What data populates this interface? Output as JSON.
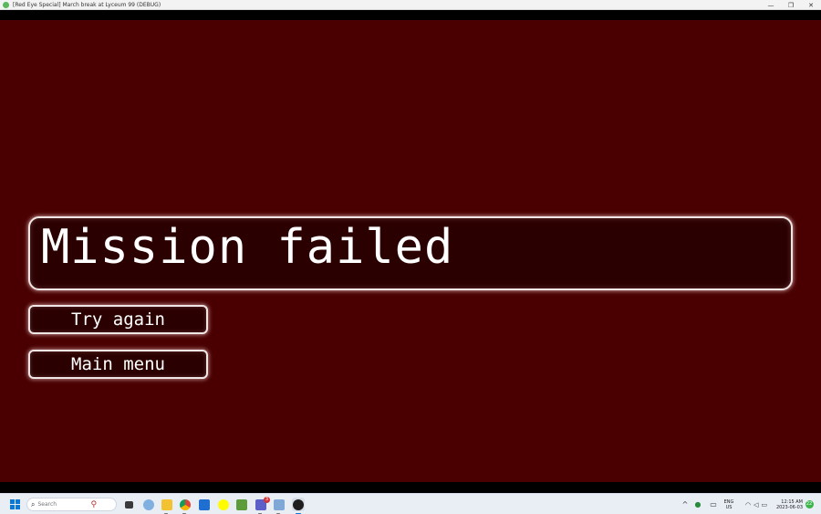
{
  "window": {
    "title": "[Red Eye Special] March break at Lyceum 99 (DEBUG)",
    "minimize": "—",
    "maximize": "❐",
    "close": "✕"
  },
  "game": {
    "heading": "Mission failed",
    "buttons": {
      "try_again": "Try again",
      "main_menu": "Main menu"
    },
    "colors": {
      "background": "#4a0000",
      "panel": "#2b0000",
      "border": "#f0e6e6",
      "text": "#ffffff"
    }
  },
  "taskbar": {
    "search_placeholder": "Search",
    "pinned_icons": [
      "file-explorer-icon",
      "chrome-icon",
      "store-icon",
      "minecraft-icon",
      "snapchat-icon",
      "teams-icon",
      "recycle-bin-icon",
      "game-icon"
    ],
    "teams_badge": "3",
    "tray": {
      "chevron": "^",
      "language_line1": "ENG",
      "language_line2": "US",
      "time": "12:15 AM",
      "date": "2023-06-03",
      "notifications": "22"
    }
  }
}
